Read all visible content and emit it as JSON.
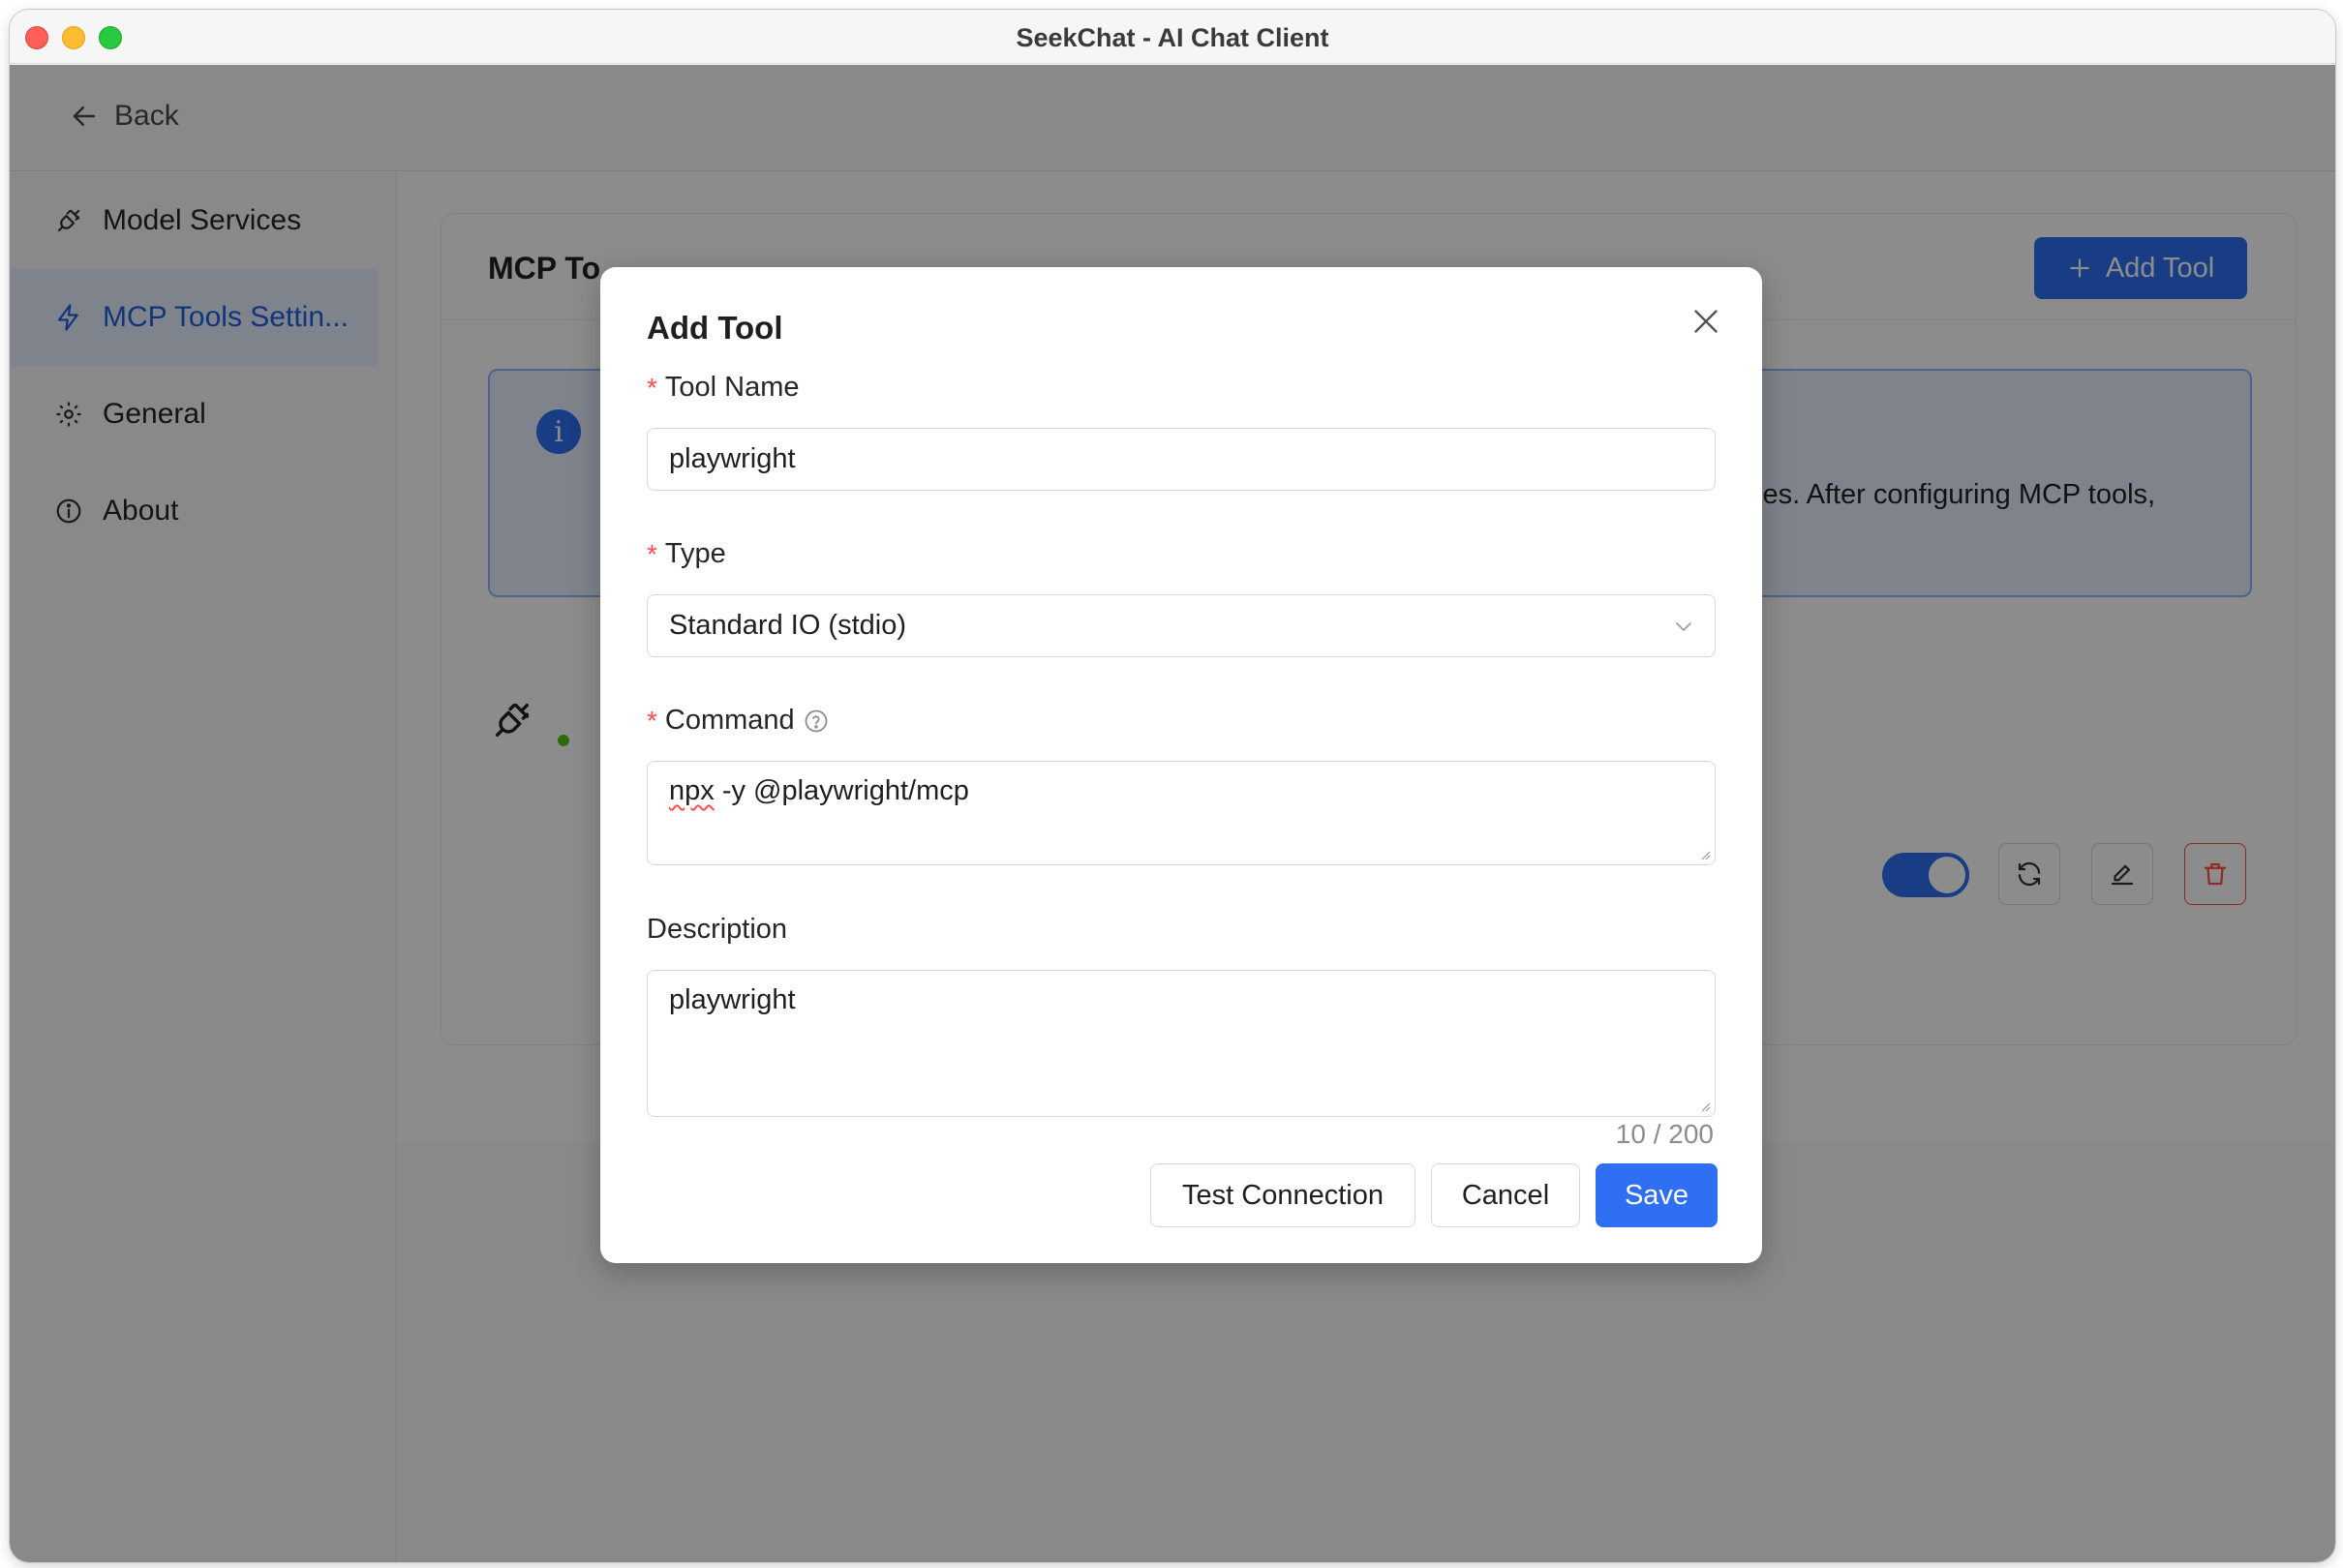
{
  "window": {
    "title": "SeekChat - AI Chat Client"
  },
  "topbar": {
    "back_label": "Back"
  },
  "sidebar": {
    "items": [
      {
        "label": "Model Services",
        "icon": "plug-icon"
      },
      {
        "label": "MCP Tools Settin...",
        "icon": "lightning-icon",
        "active": true
      },
      {
        "label": "General",
        "icon": "gear-icon"
      },
      {
        "label": "About",
        "icon": "info-circle-icon"
      }
    ]
  },
  "main": {
    "card_title": "MCP To",
    "add_tool_label": "Add Tool",
    "info_text": "ies. After configuring MCP tools,",
    "tool_enabled": true
  },
  "modal": {
    "title": "Add Tool",
    "fields": {
      "tool_name": {
        "label": "Tool Name",
        "required": true,
        "value": "playwright"
      },
      "type": {
        "label": "Type",
        "required": true,
        "value": "Standard IO (stdio)"
      },
      "command": {
        "label": "Command",
        "required": true,
        "value_word1": "npx",
        "value_rest": " -y @playwright/mcp"
      },
      "description": {
        "label": "Description",
        "required": false,
        "value": "playwright",
        "counter": "10 / 200"
      }
    },
    "buttons": {
      "test": "Test Connection",
      "cancel": "Cancel",
      "save": "Save"
    }
  },
  "colors": {
    "accent": "#2f6ff3",
    "danger": "#ff4d4f",
    "success": "#52c41a"
  }
}
